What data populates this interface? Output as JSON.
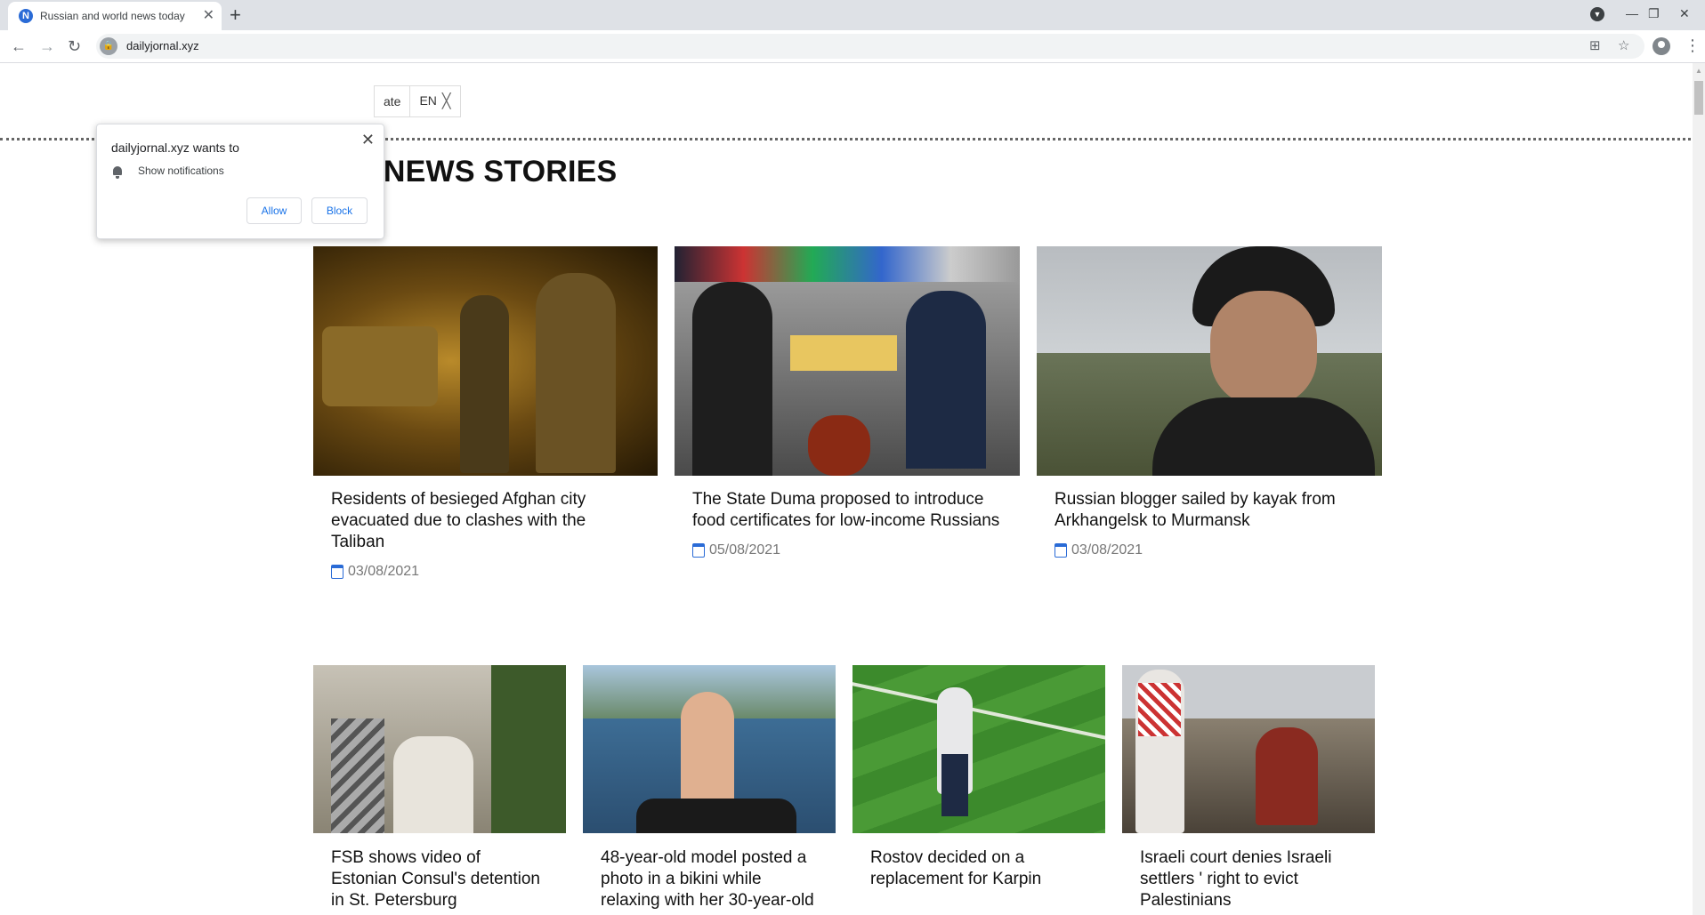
{
  "browser": {
    "tab_title": "Russian and world news today",
    "tab_favicon_letter": "N",
    "url": "dailyjornal.xyz"
  },
  "notification_prompt": {
    "title": "dailyjornal.xyz wants to",
    "permission": "Show notifications",
    "allow_label": "Allow",
    "block_label": "Block"
  },
  "language_bar": {
    "translate_fragment": "ate",
    "lang": "EN"
  },
  "section_title": "TOP NEWS STORIES",
  "top_stories": [
    {
      "headline": "Residents of besieged Afghan city evacuated due to clashes with the Taliban",
      "date": "03/08/2021"
    },
    {
      "headline": "The State Duma proposed to introduce food certificates for low-income Russians",
      "date": "05/08/2021"
    },
    {
      "headline": "Russian blogger sailed by kayak from Arkhangelsk to Murmansk",
      "date": "03/08/2021"
    }
  ],
  "more_stories": [
    {
      "headline": "FSB shows video of Estonian Consul's detention in St. Petersburg"
    },
    {
      "headline": "48-year-old model posted a photo in a bikini while relaxing with her 30-year-old"
    },
    {
      "headline": "Rostov decided on a replacement for Karpin"
    },
    {
      "headline": "Israeli court denies Israeli settlers ' right to evict Palestinians"
    }
  ]
}
